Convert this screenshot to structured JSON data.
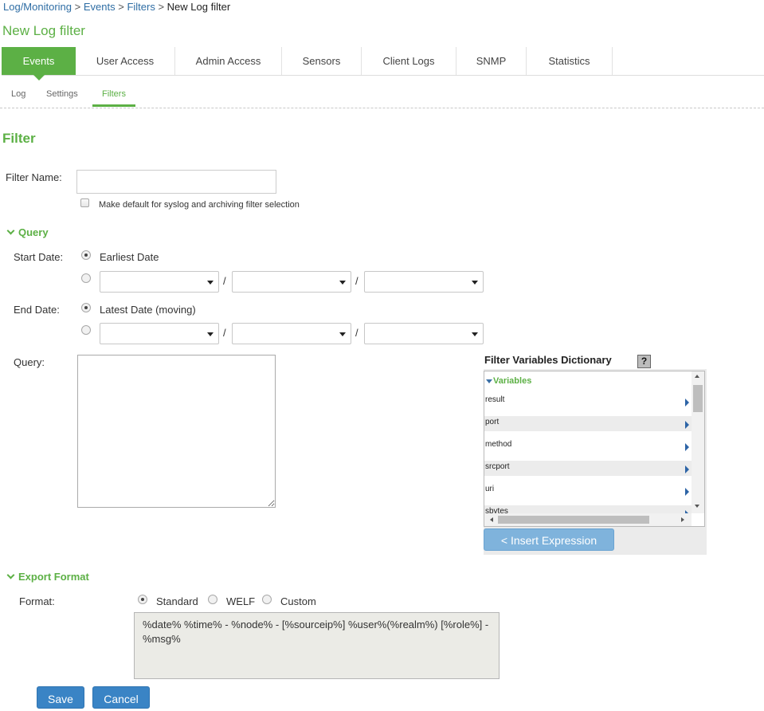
{
  "breadcrumb": {
    "items": [
      "Log/Monitoring",
      "Events",
      "Filters"
    ],
    "current": "New Log filter",
    "separator": ">"
  },
  "page_title": "New Log filter",
  "tabs": [
    {
      "label": "Events",
      "active": true
    },
    {
      "label": "User Access"
    },
    {
      "label": "Admin Access"
    },
    {
      "label": "Sensors"
    },
    {
      "label": "Client Logs"
    },
    {
      "label": "SNMP"
    },
    {
      "label": "Statistics"
    }
  ],
  "subtabs": [
    {
      "label": "Log"
    },
    {
      "label": "Settings"
    },
    {
      "label": "Filters",
      "active": true
    }
  ],
  "filter": {
    "section_title": "Filter",
    "name_label": "Filter Name:",
    "name_value": "",
    "default_checkbox_label": "Make default for syslog and archiving filter selection",
    "default_checked": false
  },
  "query": {
    "section_label": "Query",
    "start_label": "Start Date:",
    "start_option": "Earliest Date",
    "end_label": "End Date:",
    "end_option": "Latest Date (moving)",
    "date_separator": "/",
    "query_label": "Query:",
    "query_value": ""
  },
  "dictionary": {
    "title": "Filter Variables Dictionary",
    "help_icon": "?",
    "variables_header": "Variables",
    "variables": [
      "result",
      "port",
      "method",
      "srcport",
      "uri",
      "sbytes"
    ],
    "insert_button": "< Insert Expression"
  },
  "export": {
    "section_label": "Export Format",
    "format_label": "Format:",
    "options": [
      "Standard",
      "WELF",
      "Custom"
    ],
    "selected": "Standard",
    "format_string": "%date% %time% - %node% - [%sourceip%] %user%(%realm%) [%role%] - %msg%"
  },
  "actions": {
    "save": "Save",
    "cancel": "Cancel"
  },
  "colors": {
    "accent_green": "#5cb045",
    "link_blue": "#2e6da4",
    "button_blue": "#3a84c5",
    "insert_button_blue": "#7fb3dc"
  }
}
